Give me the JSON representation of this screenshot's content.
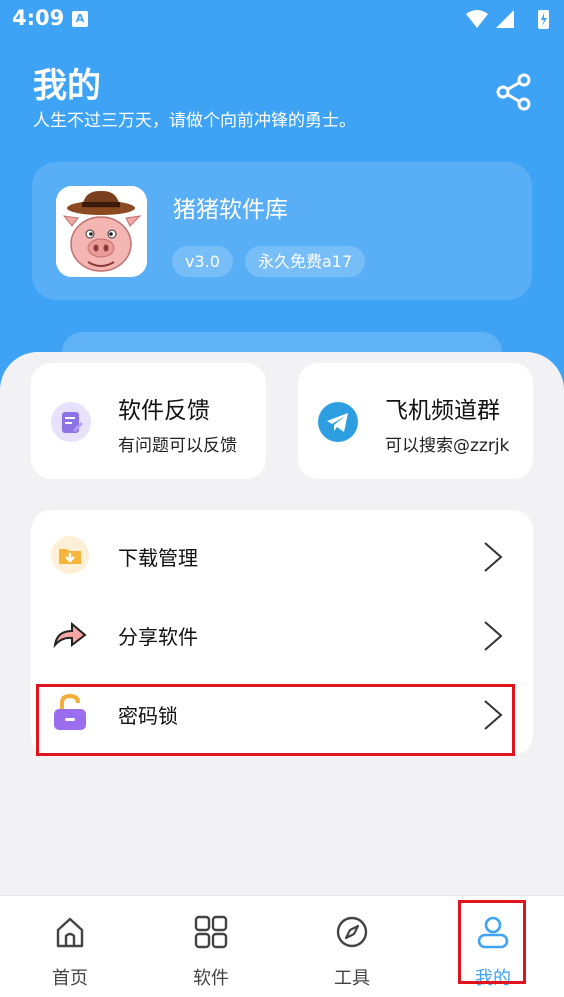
{
  "status_bar": {
    "time": "4:09",
    "notif_icon_text": "A"
  },
  "header": {
    "title": "我的",
    "subtitle": "人生不过三万天，请做个向前冲锋的勇士。"
  },
  "app_card": {
    "name": "猪猪软件库",
    "version_tag": "v3.0",
    "license_tag": "永久免费a17"
  },
  "quick_cards": [
    {
      "title": "软件反馈",
      "subtitle": "有问题可以反馈",
      "icon": "feedback-icon"
    },
    {
      "title": "飞机频道群",
      "subtitle": "可以搜索@zzrjk",
      "icon": "telegram-icon"
    }
  ],
  "menu": [
    {
      "label": "下载管理",
      "icon": "download-folder-icon"
    },
    {
      "label": "分享软件",
      "icon": "share-arrow-icon"
    },
    {
      "label": "密码锁",
      "icon": "padlock-icon"
    }
  ],
  "tabs": [
    {
      "label": "首页",
      "icon": "home-icon"
    },
    {
      "label": "软件",
      "icon": "grid-icon"
    },
    {
      "label": "工具",
      "icon": "compass-icon"
    },
    {
      "label": "我的",
      "icon": "profile-icon",
      "active": true
    }
  ],
  "colors": {
    "accent": "#3ea2f5",
    "highlight": "#e0141e",
    "background": "#f2f2f4"
  }
}
